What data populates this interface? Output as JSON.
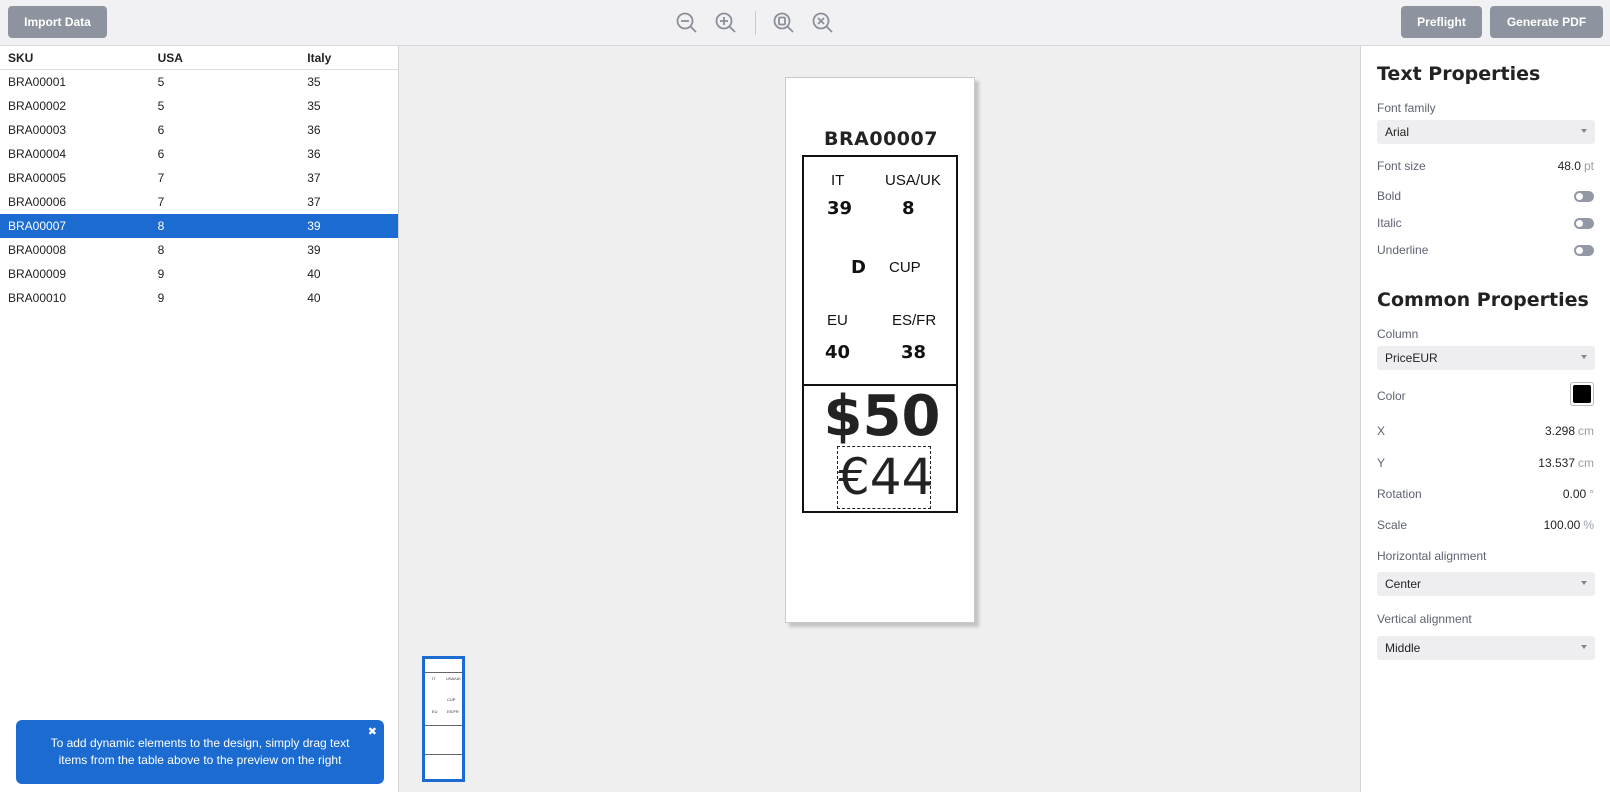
{
  "toolbar": {
    "import_label": "Import Data",
    "preflight_label": "Preflight",
    "generate_label": "Generate PDF",
    "icons": [
      "zoom-out-icon",
      "zoom-in-icon",
      "zoom-fit-icon",
      "zoom-full-icon"
    ]
  },
  "table": {
    "headers": [
      "SKU",
      "USA",
      "Italy"
    ],
    "rows": [
      [
        "BRA00001",
        "5",
        "35"
      ],
      [
        "BRA00002",
        "5",
        "35"
      ],
      [
        "BRA00003",
        "6",
        "36"
      ],
      [
        "BRA00004",
        "6",
        "36"
      ],
      [
        "BRA00005",
        "7",
        "37"
      ],
      [
        "BRA00006",
        "7",
        "37"
      ],
      [
        "BRA00007",
        "8",
        "39"
      ],
      [
        "BRA00008",
        "8",
        "39"
      ],
      [
        "BRA00009",
        "9",
        "40"
      ],
      [
        "BRA00010",
        "9",
        "40"
      ]
    ],
    "selected_row": 6
  },
  "hint": {
    "text": "To add dynamic elements to the design, simply drag text items from the table above to the preview on the right",
    "close_glyph": "✖"
  },
  "label": {
    "sku": "BRA00007",
    "it_label": "IT",
    "it_value": "39",
    "usauk_label": "USA/UK",
    "usauk_value": "8",
    "cup_value": "D",
    "cup_label": "CUP",
    "eu_label": "EU",
    "eu_value": "40",
    "esfr_label": "ES/FR",
    "esfr_value": "38",
    "price_usd": "$50",
    "price_eur": "€44"
  },
  "thumbnail": {
    "it_label": "IT",
    "usauk_label": "USA/UK",
    "cup_label": "CUP",
    "eu_label": "EU",
    "esfr_label": "ES/FR"
  },
  "text_properties": {
    "title": "Text Properties",
    "font_family_label": "Font family",
    "font_family_value": "Arial",
    "font_size_label": "Font size",
    "font_size_value": "48.0",
    "font_size_unit": "pt",
    "bold_label": "Bold",
    "italic_label": "Italic",
    "underline_label": "Underline"
  },
  "common_properties": {
    "title": "Common Properties",
    "column_label": "Column",
    "column_value": "PriceEUR",
    "color_label": "Color",
    "color_value": "#000000",
    "x_label": "X",
    "x_value": "3.298",
    "x_unit": "cm",
    "y_label": "Y",
    "y_value": "13.537",
    "y_unit": "cm",
    "rotation_label": "Rotation",
    "rotation_value": "0.00",
    "rotation_unit": "°",
    "scale_label": "Scale",
    "scale_value": "100.00",
    "scale_unit": "%",
    "halign_label": "Horizontal alignment",
    "halign_value": "Center",
    "valign_label": "Vertical alignment",
    "valign_value": "Middle"
  },
  "colors": {
    "accent": "#1b6bd1",
    "button_gray": "#8e949f"
  }
}
